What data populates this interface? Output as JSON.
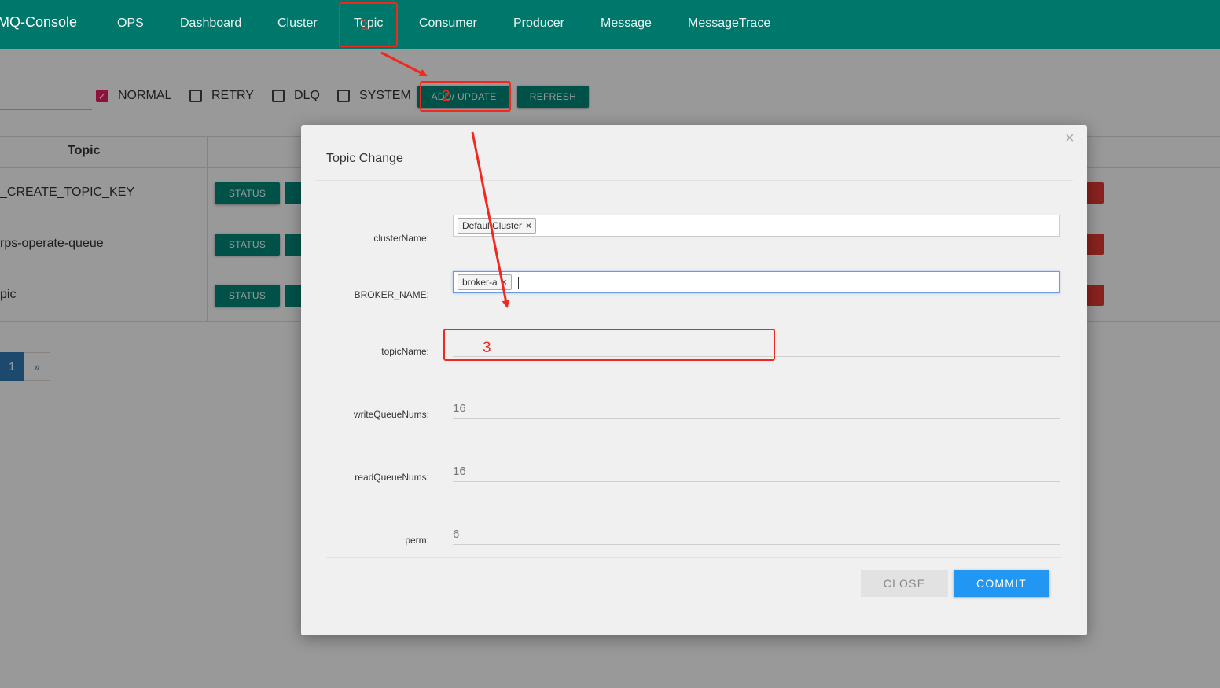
{
  "navbar": {
    "brand": "tMQ-Console",
    "items": [
      "OPS",
      "Dashboard",
      "Cluster",
      "Topic",
      "Consumer",
      "Producer",
      "Message",
      "MessageTrace"
    ]
  },
  "filters": {
    "options": [
      {
        "label": "NORMAL",
        "checked": true
      },
      {
        "label": "RETRY",
        "checked": false
      },
      {
        "label": "DLQ",
        "checked": false
      },
      {
        "label": "SYSTEM",
        "checked": false
      }
    ],
    "add_update_label": "ADD/ UPDATE",
    "refresh_label": "REFRESH"
  },
  "table": {
    "column_topic": "Topic",
    "rows": [
      {
        "topic": "_CREATE_TOPIC_KEY",
        "status_label": "STATUS"
      },
      {
        "topic": "rps-operate-queue",
        "status_label": "STATUS"
      },
      {
        "topic": "pic",
        "status_label": "STATUS"
      }
    ]
  },
  "pagination": {
    "current": "1",
    "next": "»"
  },
  "modal": {
    "title": "Topic Change",
    "close_x": "×",
    "fields": {
      "clusterName": {
        "label": "clusterName:",
        "chips": [
          "DefaultCluster"
        ]
      },
      "brokerName": {
        "label": "BROKER_NAME:",
        "chips": [
          "broker-a"
        ]
      },
      "topicName": {
        "label": "topicName:",
        "value": ""
      },
      "writeQueueNums": {
        "label": "writeQueueNums:",
        "value": "16"
      },
      "readQueueNums": {
        "label": "readQueueNums:",
        "value": "16"
      },
      "perm": {
        "label": "perm:",
        "value": "6"
      }
    },
    "close_label": "CLOSE",
    "commit_label": "COMMIT"
  },
  "annotations": {
    "step1": "1",
    "step2": "2",
    "step3": "3",
    "color": "#f0281e"
  },
  "colors": {
    "navbar": "#00776b",
    "teal_button": "#00897b",
    "commit": "#2196f3",
    "checkbox": "#e91e63"
  }
}
